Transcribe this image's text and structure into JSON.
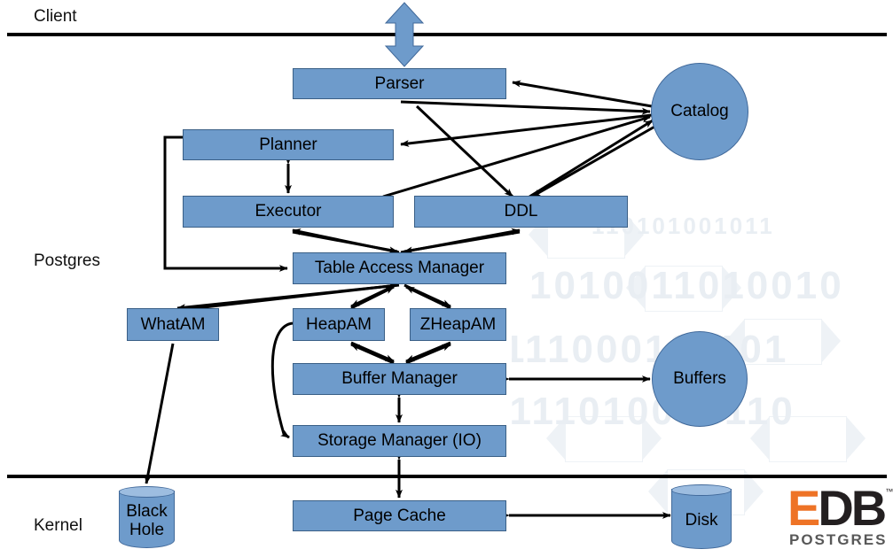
{
  "zones": [
    {
      "label": "Client"
    },
    {
      "label": "Postgres"
    },
    {
      "label": "Kernel"
    }
  ],
  "colors": {
    "node_fill": "#6E9BCB",
    "node_stroke": "#3A5F86",
    "edge": "#000000",
    "divider": "#000000",
    "logo_orange": "#EE7326",
    "logo_dark": "#231F20"
  },
  "nodes": {
    "parser": "Parser",
    "planner": "Planner",
    "executor": "Executor",
    "ddl": "DDL",
    "catalog": "Catalog",
    "table_access_manager": "Table Access Manager",
    "whatam": "WhatAM",
    "heapam": "HeapAM",
    "zheapam": "ZHeapAM",
    "buffer_manager": "Buffer Manager",
    "buffers": "Buffers",
    "storage_manager": "Storage Manager (IO)",
    "page_cache": "Page Cache",
    "disk": "Disk",
    "black_hole_line1": "Black",
    "black_hole_line2": "Hole"
  },
  "logo": {
    "letter_e": "E",
    "letter_db": "DB",
    "trademark": "™",
    "subtitle": "POSTGRES"
  },
  "watermark": {
    "rows": [
      "1010011010010",
      "111000101101",
      "0111010000110",
      "110101001011"
    ]
  }
}
